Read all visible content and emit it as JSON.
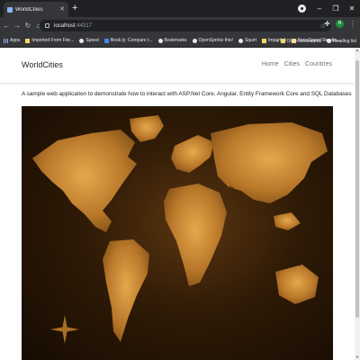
{
  "browser": {
    "tab": {
      "title": "WorldCities",
      "favicon": "page-icon"
    },
    "new_tab_symbol": "+",
    "address": {
      "host": "localhost",
      "port": ":44317"
    },
    "profile_initial": "N",
    "bookmarks": [
      {
        "label": "Apps",
        "icon": "apps-icon",
        "kind": "apps"
      },
      {
        "label": "Imported From Fire...",
        "icon": "folder-icon",
        "kind": "folder"
      },
      {
        "label": "Speed",
        "icon": "web-icon",
        "kind": "web"
      },
      {
        "label": "Book.ly: Compare t...",
        "icon": "bookly-icon",
        "kind": "blue"
      },
      {
        "label": "Bookmarks",
        "icon": "star-icon",
        "kind": "web"
      },
      {
        "label": "OpenSprintz this!",
        "icon": "web-icon",
        "kind": "web"
      },
      {
        "label": "Squirt",
        "icon": "web-icon",
        "kind": "web"
      },
      {
        "label": "Imported",
        "icon": "folder-icon",
        "kind": "folder"
      },
      {
        "label": "Free Speed Readin...",
        "icon": "folder-icon",
        "kind": "folder"
      }
    ],
    "other_bookmarks": "Other bookmarks",
    "reading_list": "Reading list"
  },
  "page": {
    "brand": "WorldCities",
    "nav": [
      "Home",
      "Cities",
      "Countries"
    ],
    "intro": "A sample web application to demonstrate how to interact with ASP.Net Core, Angular, Entity Framework Core and SQL Databases",
    "hero_image": "world-map-image"
  },
  "colors": {
    "chrome_dark": "#202124",
    "chrome_toolbar": "#35363a",
    "map_gold": "#c9872e",
    "map_dark": "#150b02"
  }
}
